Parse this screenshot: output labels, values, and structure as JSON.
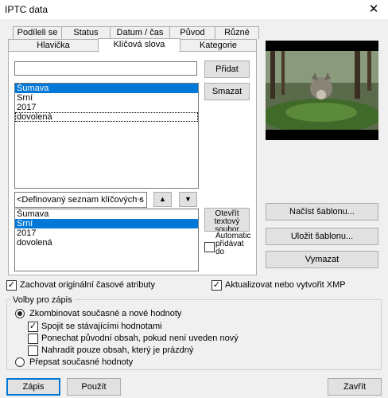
{
  "window": {
    "title": "IPTC data",
    "close_glyph": "✕"
  },
  "tabs_row1": [
    "Podíleli se",
    "Status",
    "Datum / čas",
    "Původ",
    "Různé"
  ],
  "tabs_row2": [
    "Hlavička",
    "Klíčová slova",
    "Kategorie"
  ],
  "keywords": {
    "input_value": "",
    "add_label": "Přidat",
    "delete_label": "Smazat",
    "items": [
      "Šumava",
      "Srní",
      "2017",
      "dovolená"
    ],
    "combo_value": "<Definovaný seznam klíčových s",
    "combo_arrow": "⌵",
    "up_glyph": "▲",
    "down_glyph": "▼",
    "defined_items": [
      "Šumava",
      "Srní",
      "2017",
      "dovolená"
    ],
    "open_file_label": "Otevřít textový soubor",
    "auto_add_label": "Automaticky přidávat do"
  },
  "right": {
    "load_template": "Načíst šablonu...",
    "save_template": "Uložit šablonu...",
    "clear": "Vymazat"
  },
  "options": {
    "keep_time": "Zachovat originální časové atributy",
    "update_xmp": "Aktualizovat nebo vytvořit XMP",
    "write_group": "Volby pro zápis",
    "combine": "Zkombinovat současné a nové hodnoty",
    "merge": "Spojit se stávajícími hodnotami",
    "keep_original": "Ponechat původní obsah, pokud není uveden nový",
    "replace_empty": "Nahradit pouze obsah, který je prázdný",
    "overwrite": "Přepsat současné hodnoty",
    "checkmark": "✓"
  },
  "buttons": {
    "write": "Zápis",
    "apply": "Použít",
    "close": "Zavřít"
  }
}
